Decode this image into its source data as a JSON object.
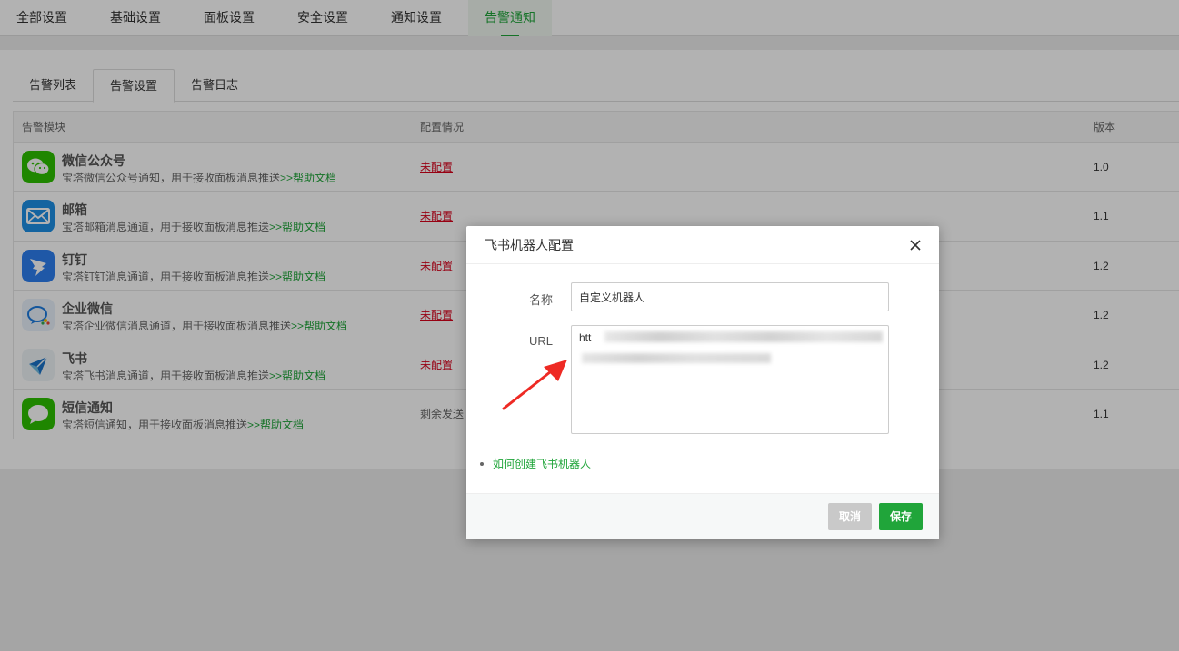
{
  "top_tabs": [
    "全部设置",
    "基础设置",
    "面板设置",
    "安全设置",
    "通知设置",
    "告警通知"
  ],
  "sub_tabs": [
    "告警列表",
    "告警设置",
    "告警日志"
  ],
  "table": {
    "headers": [
      "告警模块",
      "配置情况",
      "版本"
    ],
    "rows": [
      {
        "icon": "wechat-official-icon",
        "title": "微信公众号",
        "desc": "宝塔微信公众号通知，用于接收面板消息推送",
        "link": ">>帮助文档",
        "status": "未配置",
        "version": "1.0"
      },
      {
        "icon": "mail-icon",
        "title": "邮箱",
        "desc": "宝塔邮箱消息通道，用于接收面板消息推送",
        "link": ">>帮助文档",
        "status": "未配置",
        "version": "1.1"
      },
      {
        "icon": "dingtalk-icon",
        "title": "钉钉",
        "desc": "宝塔钉钉消息通道，用于接收面板消息推送",
        "link": ">>帮助文档",
        "status": "未配置",
        "version": "1.2"
      },
      {
        "icon": "wecom-icon",
        "title": "企业微信",
        "desc": "宝塔企业微信消息通道，用于接收面板消息推送",
        "link": ">>帮助文档",
        "status": "未配置",
        "version": "1.2"
      },
      {
        "icon": "feishu-icon",
        "title": "飞书",
        "desc": "宝塔飞书消息通道，用于接收面板消息推送",
        "link": ">>帮助文档",
        "status": "未配置",
        "version": "1.2"
      },
      {
        "icon": "sms-icon",
        "title": "短信通知",
        "desc": "宝塔短信通知，用于接收面板消息推送",
        "link": ">>帮助文档",
        "status": "剩余发送",
        "version": "1.1"
      }
    ]
  },
  "dialog": {
    "title": "飞书机器人配置",
    "name_label": "名称",
    "name_value": "自定义机器人",
    "url_label": "URL",
    "url_value": "htt",
    "howto_link": "如何创建飞书机器人",
    "cancel": "取消",
    "save": "保存"
  },
  "colors": {
    "accent": "#20a53a",
    "warning": "#d9001b",
    "annotation_arrow": "#ee2a24"
  }
}
